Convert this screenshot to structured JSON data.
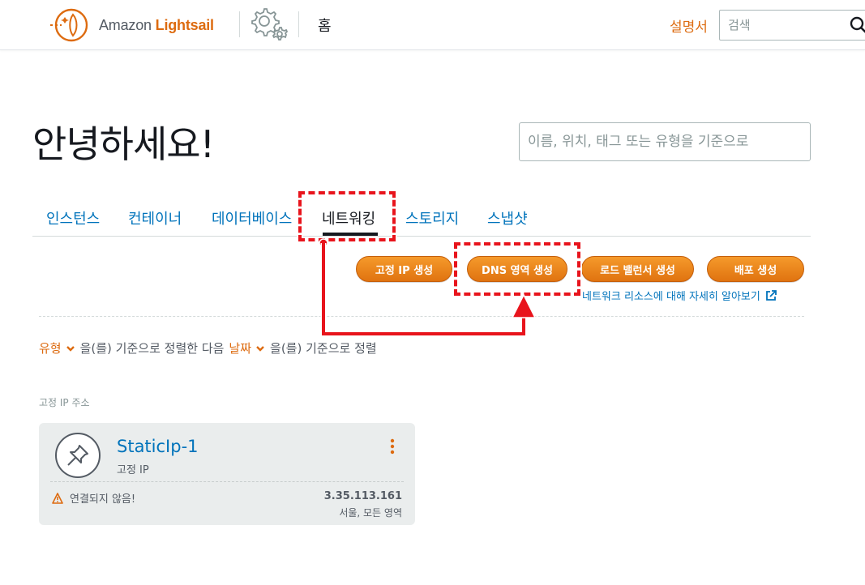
{
  "header": {
    "logo": {
      "brand": "Amazon",
      "product": "Lightsail"
    },
    "home_label": "홈",
    "docs_label": "설명서",
    "search_placeholder": "검색"
  },
  "greeting": "안녕하세요!",
  "filter_placeholder": "이름, 위치, 태그 또는 유형을 기준으로",
  "tabs": [
    {
      "label": "인스턴스"
    },
    {
      "label": "컨테이너"
    },
    {
      "label": "데이터베이스"
    },
    {
      "label": "네트워킹",
      "active": true
    },
    {
      "label": "스토리지"
    },
    {
      "label": "스냅샷"
    }
  ],
  "actions": {
    "static_ip": "고정 IP 생성",
    "dns_zone": "DNS 영역 생성",
    "load_balancer": "로드 밸런서 생성",
    "distribution": "배포 생성",
    "learn_more": "네트워크 리소스에 대해 자세히 알아보기"
  },
  "sort": {
    "key1": "유형",
    "text1": "을(를) 기준으로 정렬한 다음",
    "key2": "날짜",
    "text2": "을(를) 기준으로 정렬"
  },
  "section_label": "고정 IP 주소",
  "card": {
    "name": "StaticIp-1",
    "type": "고정 IP",
    "status": "연결되지 않음!",
    "ip": "3.35.113.161",
    "region": "서울, 모든 영역"
  },
  "colors": {
    "accent_orange": "#dd6b10",
    "link_blue": "#0073bb",
    "annotation_red": "#e8141c"
  },
  "icons": [
    "lightsail-logo-icon",
    "gear-icon",
    "search-icon",
    "chevron-down-icon",
    "external-link-icon",
    "pin-icon",
    "kebab-menu-icon",
    "warning-icon"
  ]
}
